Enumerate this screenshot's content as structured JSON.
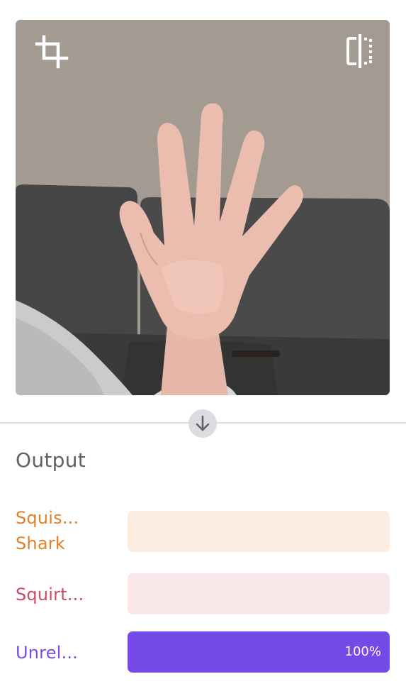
{
  "output": {
    "title": "Output",
    "classes": [
      {
        "label": "Squis...\nShark",
        "percent": 0,
        "percent_text": "",
        "color": "#e0802b",
        "track_color": "#fcebdf"
      },
      {
        "label": "Squirt...",
        "percent": 0,
        "percent_text": "",
        "color": "#cf4a6a",
        "track_color": "#f9e7e9"
      },
      {
        "label": "Unrel...",
        "percent": 100,
        "percent_text": "100%",
        "color": "#7b4de6",
        "track_color": "#ece6fb"
      }
    ]
  },
  "preview": {
    "icons": [
      "crop-icon",
      "flip-icon"
    ]
  },
  "divider": {
    "icon": "arrow-down-icon"
  }
}
